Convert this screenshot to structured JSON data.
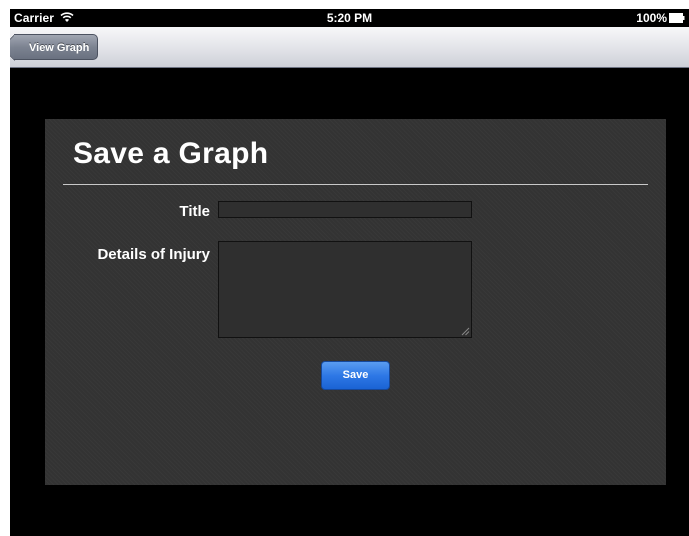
{
  "status_bar": {
    "carrier": "Carrier",
    "wifi_icon": "wifi-icon",
    "time": "5:20 PM",
    "battery_percent": "100%",
    "battery_icon": "battery-icon"
  },
  "nav_bar": {
    "back_label": "View Graph"
  },
  "form": {
    "title": "Save a Graph",
    "title_field_label": "Title",
    "title_field_value": "",
    "details_field_label": "Details of Injury",
    "details_field_value": "",
    "save_label": "Save"
  },
  "colors": {
    "background": "#000000",
    "panel": "#333333",
    "save_button": "#2e78e6",
    "nav_bar": "#e2e3e8"
  }
}
